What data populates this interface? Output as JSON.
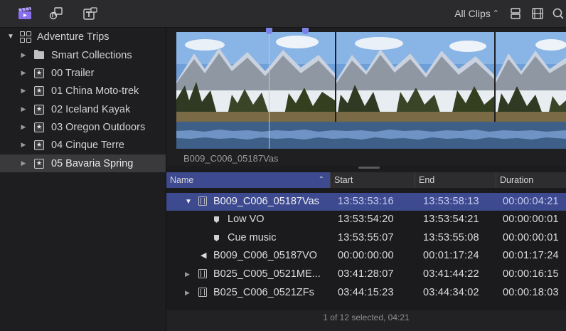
{
  "toolbar": {
    "left_icons": [
      "clapperboard-icon",
      "music-photos-icon",
      "titles-generators-icon"
    ],
    "filter_label": "All Clips",
    "right_icons": [
      "clip-appearance-icon",
      "filmstrip-view-icon",
      "search-icon"
    ]
  },
  "sidebar": {
    "library": {
      "label": "Adventure Trips",
      "expanded": true
    },
    "items": [
      {
        "label": "Smart Collections",
        "icon": "folder-icon"
      },
      {
        "label": "00 Trailer",
        "icon": "event-icon"
      },
      {
        "label": "01 China Moto-trek",
        "icon": "event-icon"
      },
      {
        "label": "02 Iceland Kayak",
        "icon": "event-icon"
      },
      {
        "label": "03 Oregon Outdoors",
        "icon": "event-icon"
      },
      {
        "label": "04 Cinque Terre",
        "icon": "event-icon"
      },
      {
        "label": "05 Bavaria Spring",
        "icon": "event-icon",
        "selected": true
      }
    ]
  },
  "filmstrip": {
    "clip_name": "B009_C006_05187Vas"
  },
  "list": {
    "columns": [
      "Name",
      "Start",
      "End",
      "Duration"
    ],
    "rows": [
      {
        "name": "B009_C006_05187Vas",
        "start": "13:53:53:16",
        "end": "13:53:58:13",
        "duration": "00:00:04:21",
        "kind": "clip",
        "expanded": true,
        "selected": true
      },
      {
        "name": "Low VO",
        "start": "13:53:54:20",
        "end": "13:53:54:21",
        "duration": "00:00:00:01",
        "kind": "marker"
      },
      {
        "name": "Cue music",
        "start": "13:53:55:07",
        "end": "13:53:55:08",
        "duration": "00:00:00:01",
        "kind": "marker"
      },
      {
        "name": "B009_C006_05187VO",
        "start": "00:00:00:00",
        "end": "00:01:17:24",
        "duration": "00:01:17:24",
        "kind": "audio"
      },
      {
        "name": "B025_C005_0521ME...",
        "start": "03:41:28:07",
        "end": "03:41:44:22",
        "duration": "00:00:16:15",
        "kind": "clip"
      },
      {
        "name": "B025_C006_0521ZFs",
        "start": "03:44:15:23",
        "end": "03:44:34:02",
        "duration": "00:00:18:03",
        "kind": "clip"
      }
    ],
    "status": "1 of 12 selected, 04:21"
  },
  "colors": {
    "selection": "#3d4a8f",
    "waveform": "#3e5f87",
    "accent": "#7b83e8"
  }
}
